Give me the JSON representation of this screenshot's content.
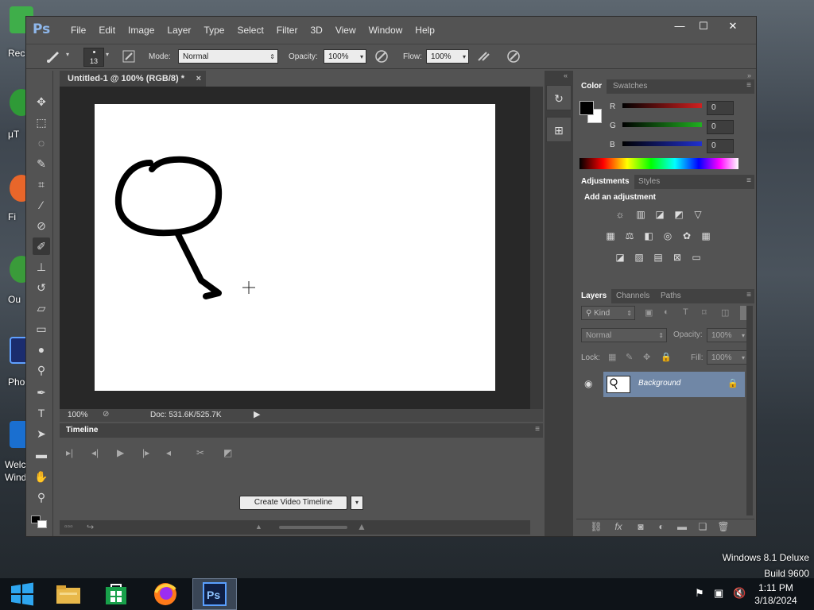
{
  "desktop": {
    "icons": [
      {
        "label": "Rec",
        "color": "#3fae4a"
      },
      {
        "label": "μT",
        "color": "#2f9a37"
      },
      {
        "label": "Fi",
        "color": "#e8662a"
      },
      {
        "label": "Ou",
        "color": "#3a9b3a"
      },
      {
        "label": "Pho",
        "color": "#1b2c6e"
      },
      {
        "label": "Welc",
        "color": "#1a6fd0"
      },
      {
        "label": "Wind",
        "color": "#1a6fd0"
      }
    ]
  },
  "app": {
    "logo": "Ps",
    "menu": [
      "File",
      "Edit",
      "Image",
      "Layer",
      "Type",
      "Select",
      "Filter",
      "3D",
      "View",
      "Window",
      "Help"
    ],
    "window_controls": {
      "minimize": "—",
      "maximize": "☐",
      "close": "✕"
    }
  },
  "options": {
    "brush_size": "13",
    "mode_label": "Mode:",
    "mode_value": "Normal",
    "opacity_label": "Opacity:",
    "opacity_value": "100%",
    "flow_label": "Flow:",
    "flow_value": "100%"
  },
  "document": {
    "tab_title": "Untitled-1 @ 100% (RGB/8) *",
    "tab_close": "×",
    "zoom": "100%",
    "doc_info": "Doc: 531.6K/525.7K"
  },
  "timeline": {
    "title": "Timeline",
    "create_button": "Create Video Timeline"
  },
  "color_panel": {
    "tabs": [
      "Color",
      "Swatches"
    ],
    "channels": [
      {
        "name": "R",
        "value": "0",
        "color": "#d02020"
      },
      {
        "name": "G",
        "value": "0",
        "color": "#20b020"
      },
      {
        "name": "B",
        "value": "0",
        "color": "#2030d0"
      }
    ]
  },
  "adjustments_panel": {
    "tabs": [
      "Adjustments",
      "Styles"
    ],
    "heading": "Add an adjustment"
  },
  "layers_panel": {
    "tabs": [
      "Layers",
      "Channels",
      "Paths"
    ],
    "filter_label": "Kind",
    "blend_mode": "Normal",
    "opacity_label": "Opacity:",
    "opacity_value": "100%",
    "lock_label": "Lock:",
    "fill_label": "Fill:",
    "fill_value": "100%",
    "layers": [
      {
        "name": "Background",
        "locked": true,
        "visible": true
      }
    ]
  },
  "taskbar": {
    "time": "1:11 PM",
    "date": "3/18/2024",
    "apps": [
      "start",
      "file-explorer",
      "store",
      "firefox",
      "photoshop"
    ]
  },
  "watermark": {
    "line1": "Windows 8.1 Deluxe",
    "line2": "Build 9600"
  }
}
